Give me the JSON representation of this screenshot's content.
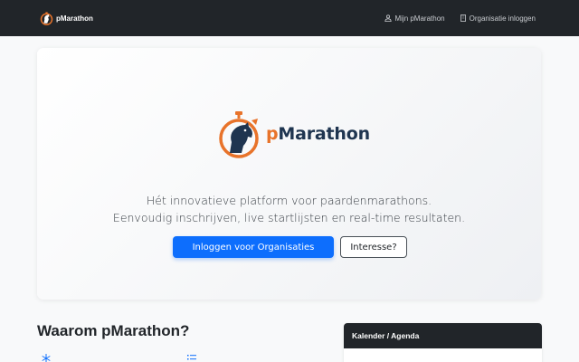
{
  "navbar": {
    "brand": "pMarathon",
    "links": [
      {
        "label": "Mijn pMarathon",
        "icon": "user-icon"
      },
      {
        "label": "Organisatie inloggen",
        "icon": "building-icon"
      }
    ]
  },
  "hero": {
    "logo_prefix": "p",
    "logo_text": "Marathon",
    "tagline_line1": "Hét innovatieve platform voor paardenmarathons.",
    "tagline_line2": "Eenvoudig inschrijven, live startlijsten en real-time resultaten.",
    "primary_button": "Inloggen voor Organisaties",
    "secondary_button": "Interesse?"
  },
  "section": {
    "title": "Waarom pMarathon?",
    "feature_icons": [
      "snowflake-icon",
      "list-icon"
    ]
  },
  "calendar": {
    "title": "Kalender / Agenda"
  },
  "colors": {
    "navbar": "#212529",
    "primary": "#0d6efd",
    "brand_orange": "#e8732a",
    "brand_navy": "#1f3550"
  }
}
